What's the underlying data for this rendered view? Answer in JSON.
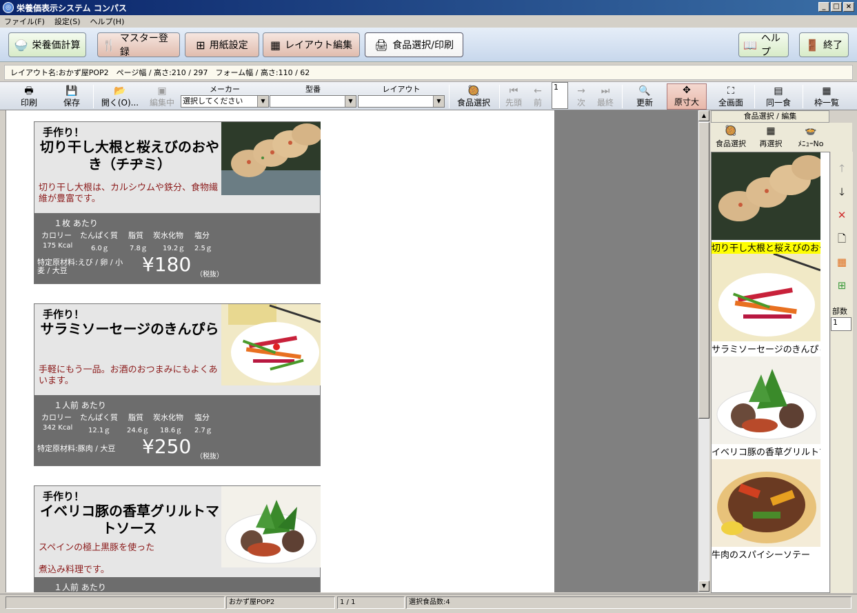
{
  "window": {
    "title": "栄養価表示システム コンパス",
    "minimize": "_",
    "maximize": "□",
    "close": "×"
  },
  "menu": [
    "ファイル(F)",
    "設定(S)",
    "ヘルプ(H)"
  ],
  "mainbar": {
    "calc": "栄養価計算",
    "master": "マスター登録",
    "paper": "用紙設定",
    "layout": "レイアウト編集",
    "select_print": "食品選択/印刷",
    "help": "ヘルプ",
    "exit": "終了"
  },
  "info": "レイアウト名:おかず屋POP2　ページ幅 / 高さ:210 / 297　フォーム幅 / 高さ:110 / 62",
  "toolbar": {
    "print": "印刷",
    "save": "保存",
    "open": "開く(O)...",
    "editing": "編集中",
    "maker_label": "メーカー",
    "maker_value": "選択してください",
    "model_label": "型番",
    "model_value": "",
    "layout_label": "レイアウト",
    "layout_value": "",
    "food_select": "食品選択",
    "first": "先頭",
    "prev": "前",
    "page": "1",
    "next": "次",
    "last": "最終",
    "refresh": "更新",
    "actual_size": "原寸大",
    "fullscreen": "全画面",
    "same_meal": "同一食",
    "frame_list": "枠一覧"
  },
  "cards": [
    {
      "handmade": "手作り！",
      "name": "切り干し大根と桜えびのおやき（チヂミ）",
      "desc": "切り干し大根は、カルシウムや鉄分、食物繊維が豊富です。",
      "per": "１枚 あたり",
      "nutrient_headers": [
        "カロリー",
        "たんぱく質",
        "脂質",
        "炭水化物",
        "塩分"
      ],
      "nutrient_values": [
        "175 Kcal",
        "6.0ｇ",
        "7.8ｇ",
        "19.2ｇ",
        "2.5ｇ"
      ],
      "allergen": "特定原材料:えび / 卵 / 小麦 / 大豆",
      "price": "¥180",
      "tax": "（税抜）"
    },
    {
      "handmade": "手作り！",
      "name": "サラミソーセージのきんぴら",
      "desc": "手軽にもう一品。お酒のおつまみにもよくあいます。",
      "per": "１人前 あたり",
      "nutrient_headers": [
        "カロリー",
        "たんぱく質",
        "脂質",
        "炭水化物",
        "塩分"
      ],
      "nutrient_values": [
        "342 Kcal",
        "12.1ｇ",
        "24.6ｇ",
        "18.6ｇ",
        "2.7ｇ"
      ],
      "allergen": "特定原材料:豚肉 / 大豆",
      "price": "¥250",
      "tax": "（税抜）"
    },
    {
      "handmade": "手作り！",
      "name": "イベリコ豚の香草グリルトマトソース",
      "desc_line1": "スペインの極上黒豚を使った",
      "desc_line2": "煮込み料理です。",
      "per": "１人前 あたり"
    }
  ],
  "right_panel": {
    "header": "食品選択 / 編集",
    "tools": [
      "食品選択",
      "再選択",
      "ﾒﾆｭｰNo"
    ],
    "items": [
      "切り干し大根と桜えびのおやき",
      "サラミソーセージのきんぴら",
      "イベリコ豚の香草グリルトマトソース",
      "牛肉のスパイシーソテー"
    ],
    "copies_label": "部数",
    "copies": "1"
  },
  "status": {
    "layout": "おかず屋POP2",
    "page": "1 / 1",
    "count": "選択食品数:4"
  }
}
